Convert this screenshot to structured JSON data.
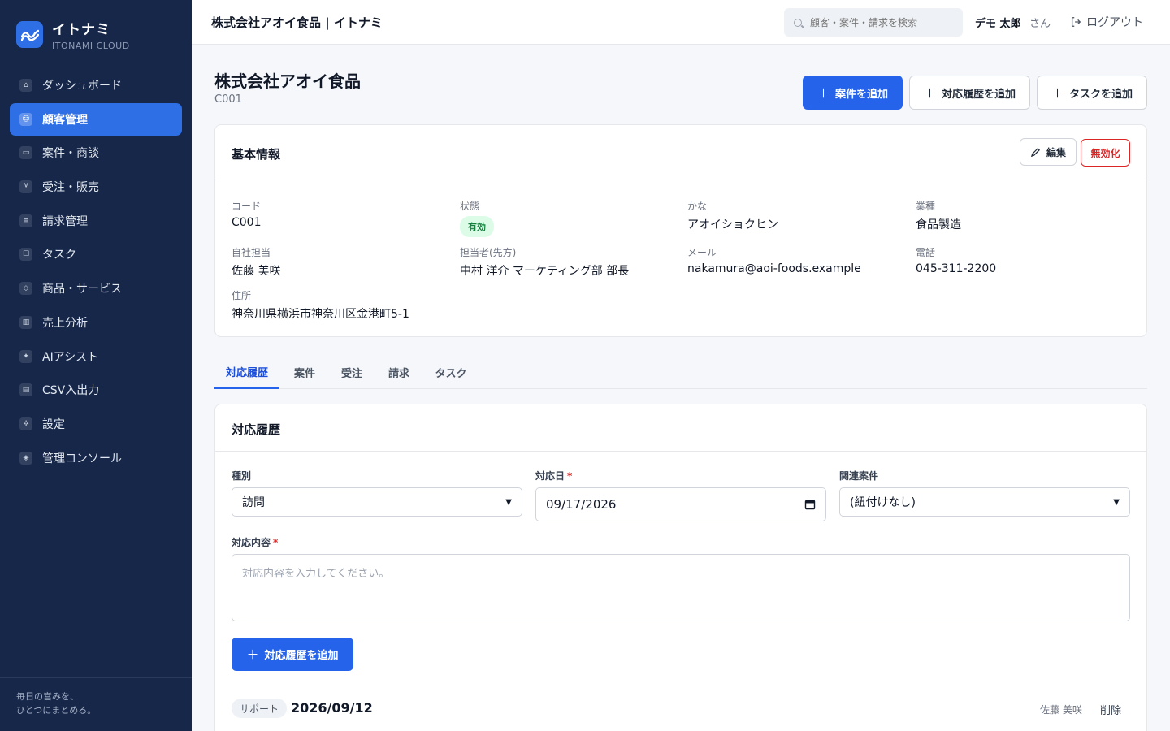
{
  "brand": {
    "name": "イトナミ",
    "sub": "ITONAMI CLOUD"
  },
  "sidebar": {
    "items": [
      {
        "label": "ダッシュボード",
        "icon": "home-icon"
      },
      {
        "label": "顧客管理",
        "icon": "users-icon",
        "active": true
      },
      {
        "label": "案件・商談",
        "icon": "briefcase-icon"
      },
      {
        "label": "受注・販売",
        "icon": "cart-icon"
      },
      {
        "label": "請求管理",
        "icon": "receipt-icon"
      },
      {
        "label": "タスク",
        "icon": "clipboard-icon"
      },
      {
        "label": "商品・サービス",
        "icon": "box-icon"
      },
      {
        "label": "売上分析",
        "icon": "bar-chart-icon"
      },
      {
        "label": "AIアシスト",
        "icon": "sparkle-icon"
      },
      {
        "label": "CSV入出力",
        "icon": "file-icon"
      },
      {
        "label": "設定",
        "icon": "gear-icon"
      },
      {
        "label": "管理コンソール",
        "icon": "shield-icon"
      }
    ],
    "footer_line1": "毎日の営みを、",
    "footer_line2": "ひとつにまとめる。"
  },
  "header": {
    "title": "株式会社アオイ食品 | イトナミ",
    "search_placeholder": "顧客・案件・請求を検索",
    "user_name": "デモ 太郎",
    "user_suffix": "さん",
    "logout": "ログアウト"
  },
  "page": {
    "title": "株式会社アオイ食品",
    "code": "C001",
    "actions": {
      "add_deal": "案件を追加",
      "add_history": "対応履歴を追加",
      "add_task": "タスクを追加"
    }
  },
  "basic_info": {
    "title": "基本情報",
    "edit": "編集",
    "disable": "無効化",
    "fields": {
      "code_label": "コード",
      "code": "C001",
      "status_label": "状態",
      "status": "有効",
      "kana_label": "かな",
      "kana": "アオイショクヒン",
      "industry_label": "業種",
      "industry": "食品製造",
      "owner_label": "自社担当",
      "owner": "佐藤 美咲",
      "contact_label": "担当者(先方)",
      "contact": "中村 洋介 マーケティング部 部長",
      "email_label": "メール",
      "email": "nakamura@aoi-foods.example",
      "phone_label": "電話",
      "phone": "045-311-2200",
      "address_label": "住所",
      "address": "神奈川県横浜市神奈川区金港町5-1"
    }
  },
  "tabs": [
    "対応履歴",
    "案件",
    "受注",
    "請求",
    "タスク"
  ],
  "history_form": {
    "title": "対応履歴",
    "type_label": "種別",
    "type_value": "訪問",
    "date_label": "対応日",
    "date_value": "09/17/2026",
    "deal_label": "関連案件",
    "deal_value": "(紐付けなし)",
    "content_label": "対応内容",
    "content_placeholder": "対応内容を入力してください。",
    "submit": "対応履歴を追加",
    "required_mark": "*"
  },
  "history_entry": {
    "tag": "サポート",
    "date": "2026/09/12",
    "user": "佐藤 美咲",
    "delete": "削除"
  },
  "colors": {
    "sidebar": "#17274a",
    "accent": "#2563eb",
    "danger": "#dc2626",
    "success": "#15803d"
  }
}
